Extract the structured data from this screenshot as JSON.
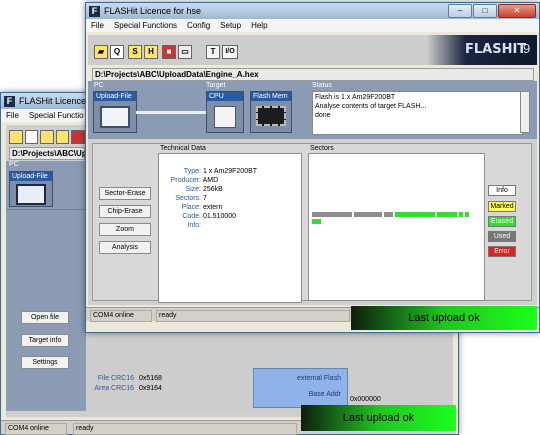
{
  "back_window": {
    "title": "FLASHit Licence fo",
    "menu": [
      "File",
      "Special Functio"
    ],
    "path": "D:\\Projects\\ABC\\Upload",
    "pc_label": "PC",
    "upload_file_label": "Upload-File",
    "buttons": [
      "Open file",
      "Target info",
      "Settings"
    ],
    "crc": [
      {
        "key": "File CRC16",
        "value": "0x5168"
      },
      {
        "key": "Area CRC16",
        "value": "0x9164"
      }
    ],
    "flash_box": {
      "line1": "external Flash",
      "line2": "Base Addr",
      "value": "0x000000"
    },
    "status": {
      "port": "COM4 online",
      "state": "ready"
    },
    "banner": "Last upload ok"
  },
  "front_window": {
    "title": "FLASHit Licence for hse",
    "menu": [
      "File",
      "Special Functions",
      "Config",
      "Setup",
      "Help"
    ],
    "toolbar": [
      "S",
      "H",
      "T",
      "I/O"
    ],
    "logo": "FLASHIT",
    "logo_version": "9",
    "path": "D:\\Projects\\ABC\\UploadData\\Engine_A.hex",
    "labels": {
      "pc": "PC",
      "target": "Target",
      "status": "Status",
      "upload_file": "Upload-File",
      "cpu": "CPU",
      "flash_mem": "Flash Mem"
    },
    "status_lines": [
      "Flash is 1 x Am29F200BT",
      "Analyse contents of target FLASH...",
      "done"
    ],
    "tech_title": "Technical Data",
    "sectors_title": "Sectors",
    "tech": [
      {
        "key": "Type:",
        "value": "1 x Am29F200BT"
      },
      {
        "key": "Producer:",
        "value": "AMD"
      },
      {
        "key": "Size:",
        "value": "256kB"
      },
      {
        "key": "Sectors:",
        "value": "7"
      },
      {
        "key": "Place:",
        "value": "extern"
      },
      {
        "key": "Code:",
        "value": "01.510000"
      },
      {
        "key": "Info:",
        "value": ""
      }
    ],
    "side_buttons": [
      "Sector-Erase",
      "Chip-Erase",
      "Zoom",
      "Analysis"
    ],
    "legend": [
      "Info",
      "Marked",
      "Erased",
      "Used",
      "Error"
    ],
    "status": {
      "port": "COM4 online",
      "state": "ready"
    },
    "banner": "Last upload ok"
  }
}
